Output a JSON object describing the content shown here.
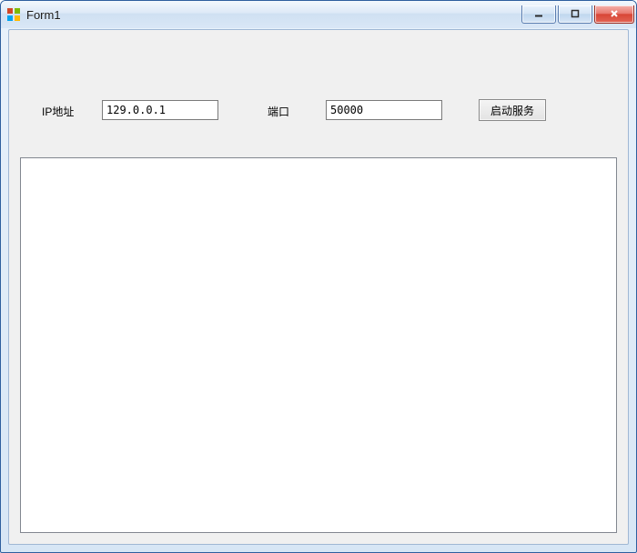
{
  "window": {
    "title": "Form1"
  },
  "form": {
    "ip_label": "IP地址",
    "ip_value": "129.0.0.1",
    "port_label": "端口",
    "port_value": "50000",
    "start_button": "启动服务",
    "log_value": ""
  }
}
